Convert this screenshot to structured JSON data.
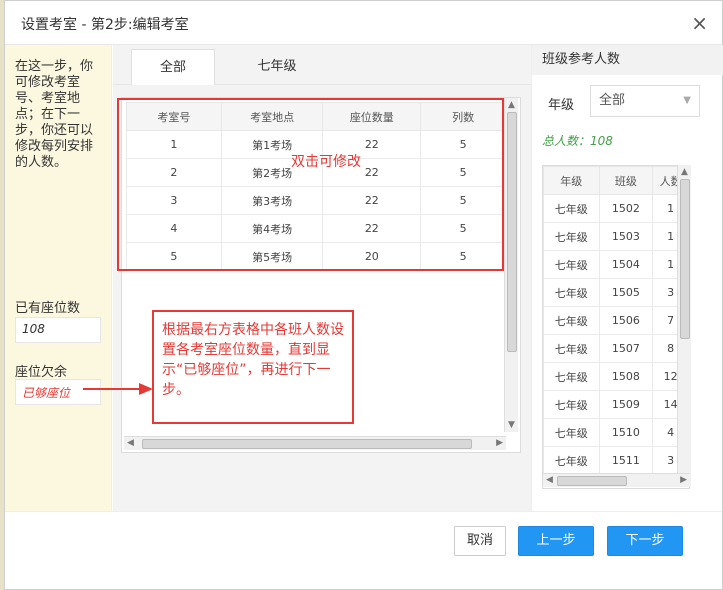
{
  "dialog": {
    "title": "设置考室 - 第2步:编辑考室",
    "close_glyph": "×"
  },
  "tip": {
    "text": "在这一步，你可修改考室号、考室地点；在下一步，你还可以修改每列安排的人数。",
    "existing_label": "已有座位数",
    "existing_value": "108",
    "remaining_label": "座位欠余",
    "remaining_value": "已够座位"
  },
  "tabs": [
    {
      "label": "全部",
      "active": true
    },
    {
      "label": "七年级",
      "active": false
    }
  ],
  "rooms": {
    "headers": [
      "考室号",
      "考室地点",
      "座位数量",
      "列数"
    ],
    "rows": [
      [
        "1",
        "第1考场",
        "22",
        "5"
      ],
      [
        "2",
        "第2考场",
        "22",
        "5"
      ],
      [
        "3",
        "第3考场",
        "22",
        "5"
      ],
      [
        "4",
        "第4考场",
        "22",
        "5"
      ],
      [
        "5",
        "第5考场",
        "20",
        "5"
      ]
    ]
  },
  "annotations": {
    "double_click": "双击可修改",
    "instruction": "根据最右方表格中各班人数设置各考室座位数量，直到显示“已够座位”，再进行下一步。",
    "color": "#e53935"
  },
  "right": {
    "title": "班级参考人数",
    "grade_label": "年级",
    "grade_value": "全部",
    "total": "总人数：108",
    "headers": [
      "年级",
      "班级",
      "人数"
    ],
    "rows": [
      [
        "七年级",
        "1502",
        "1"
      ],
      [
        "七年级",
        "1503",
        "1"
      ],
      [
        "七年级",
        "1504",
        "1"
      ],
      [
        "七年级",
        "1505",
        "3"
      ],
      [
        "七年级",
        "1506",
        "7"
      ],
      [
        "七年级",
        "1507",
        "8"
      ],
      [
        "七年级",
        "1508",
        "12"
      ],
      [
        "七年级",
        "1509",
        "14"
      ],
      [
        "七年级",
        "1510",
        "4"
      ],
      [
        "七年级",
        "1511",
        "3"
      ]
    ]
  },
  "footer": {
    "cancel": "取消",
    "prev": "上一步",
    "next": "下一步"
  },
  "colors": {
    "primary": "#2196f3",
    "tip_bg": "#fcf8e0",
    "success": "#43a047"
  }
}
